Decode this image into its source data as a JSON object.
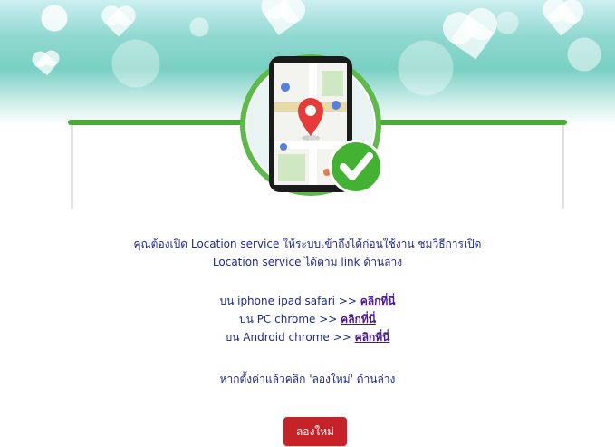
{
  "message": {
    "line1": "คุณต้องเปิด Location service ให้ระบบเข้าถึงได้ก่อนใช้งาน ชมวิธีการเปิด",
    "line2": "Location service ได้ตาม link ด้านล่าง"
  },
  "instructions": [
    {
      "prefix": "บน iphone ipad safari >>",
      "link": "คลิกที่นี่"
    },
    {
      "prefix": "บน PC chrome >>",
      "link": "คลิกที่นี่"
    },
    {
      "prefix": "บน Android chrome >>",
      "link": "คลิกที่นี่"
    }
  ],
  "retry_hint": "หากตั้งค่าแล้วคลิก 'ลองใหม่' ด้านล่าง",
  "retry_button": "ลองใหม่",
  "colors": {
    "text": "#1f2a8c",
    "link": "#4a1a8e",
    "button": "#c62328",
    "accent_green": "#4ca93a"
  }
}
